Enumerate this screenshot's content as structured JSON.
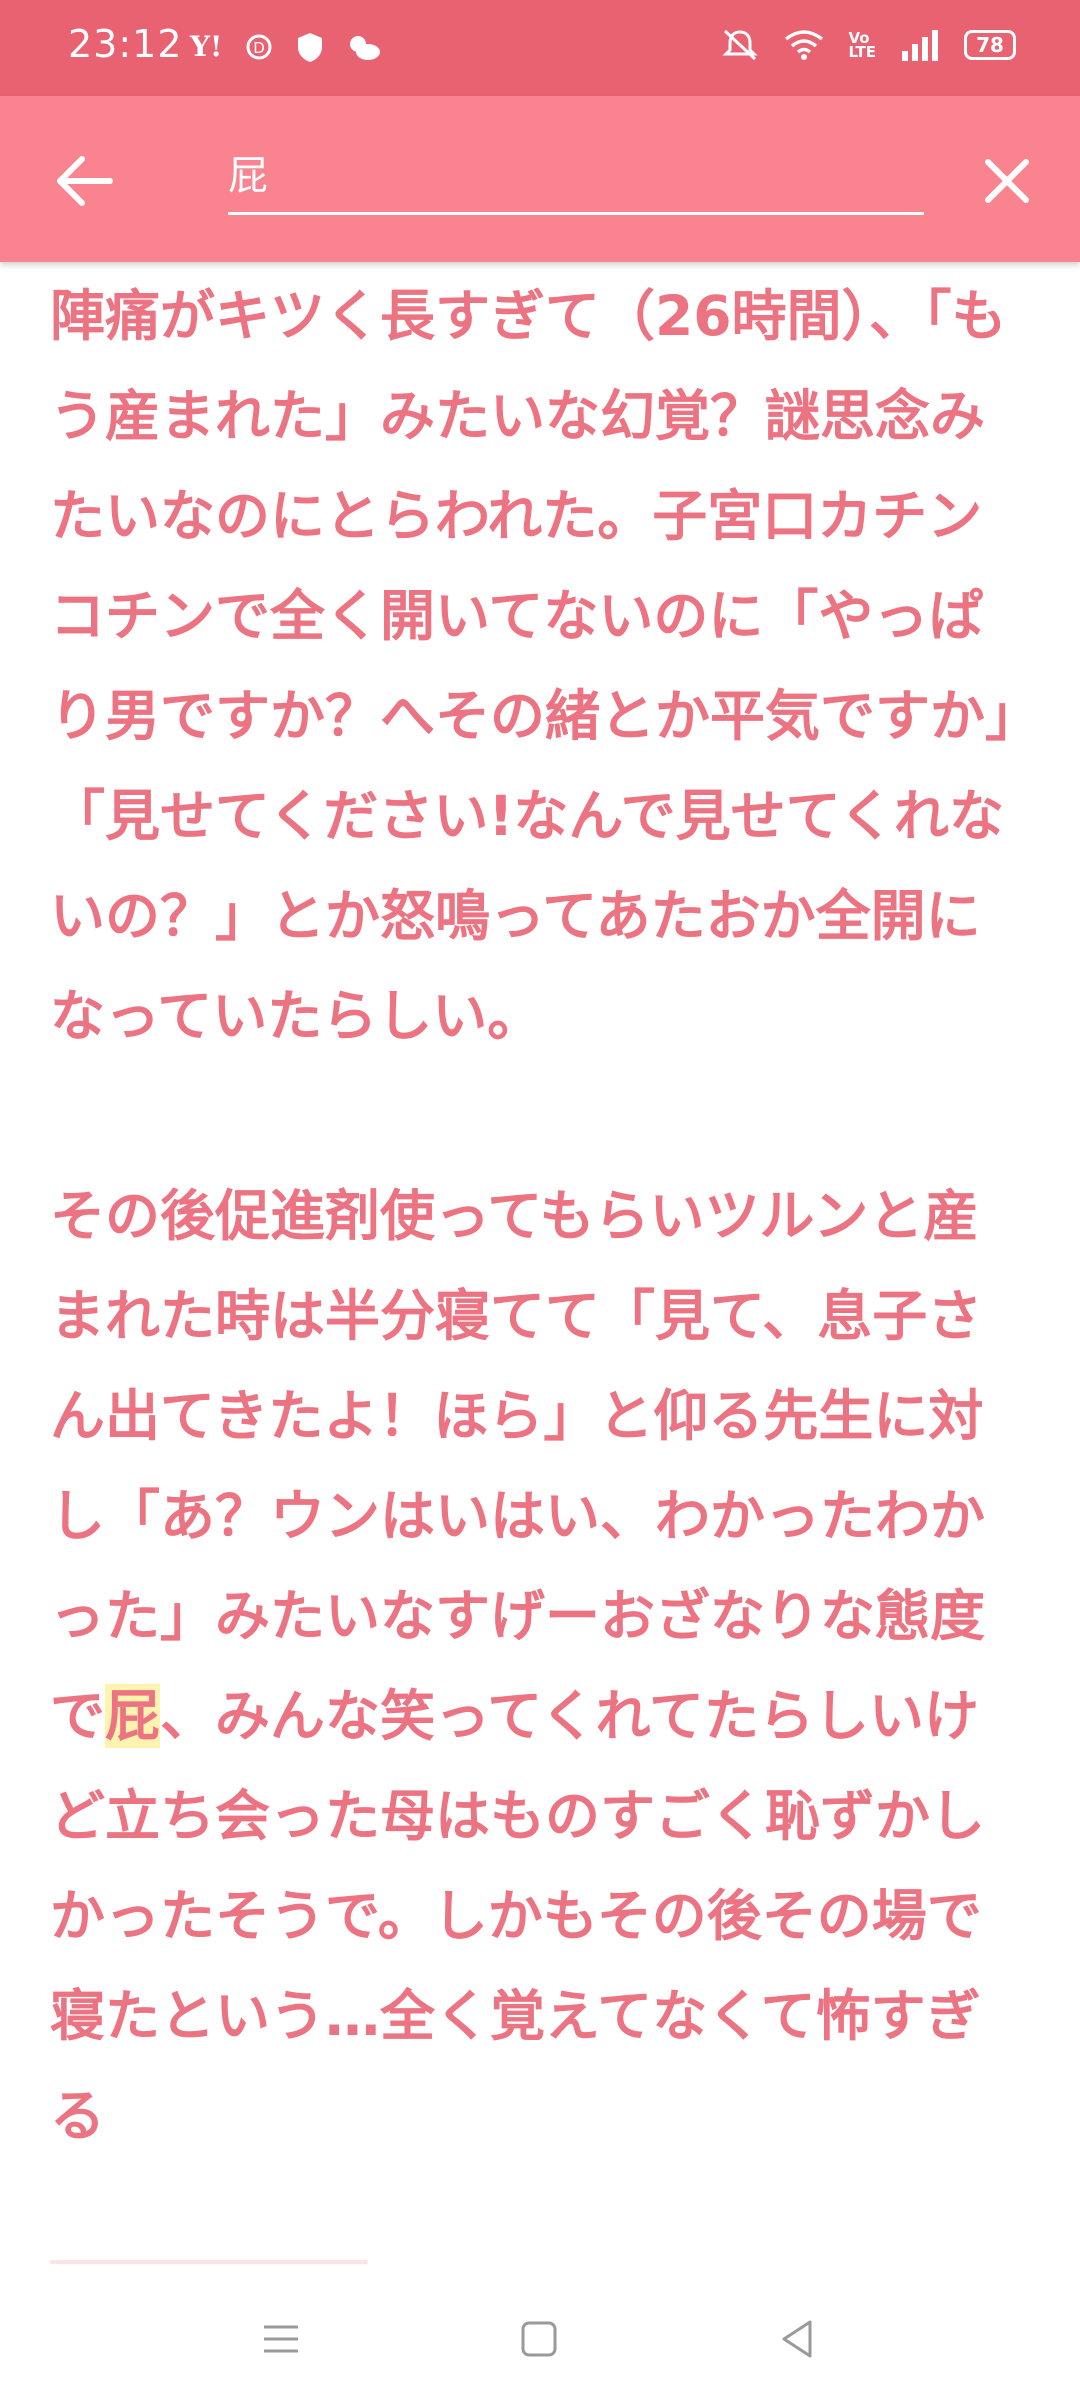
{
  "status_bar": {
    "time": "23:12",
    "left_icons": [
      "yahoo-icon",
      "data-saver-icon",
      "shield-icon",
      "weather-icon"
    ],
    "right_icons": [
      "mute-icon",
      "wifi-icon",
      "volte-icon",
      "signal-icon"
    ],
    "volte_label": "Vo\nLTE",
    "battery_level": "78"
  },
  "app_bar": {
    "search_value": "屁"
  },
  "content": {
    "paragraph1": "陣痛がキツく長すぎて（26時間）、「もう産まれた」みたいな幻覚？謎思念みたいなのにとらわれた。子宮口カチンコチンで全く開いてないのに「やっぱり男ですか？へその緒とか平気ですか」「見せてください!なんで見せてくれないの？」とか怒鳴ってあたおか全開になっていたらしい。",
    "paragraph2_before": "その後促進剤使ってもらいツルンと産まれた時は半分寝てて「見て、息子さん出てきたよ！ほら」と仰る先生に対し「あ？ウンはいはい、わかったわかった」みたいなすげーおざなりな態度で",
    "paragraph2_highlight": "屁",
    "paragraph2_after": "、みんな笑ってくれてたらしいけど立ち会った母はものすごく恥ずかしかったそうで。しかもその後その場で寝たという…全く覚えてなくて怖すぎる"
  },
  "colors": {
    "status_bar": "#e96272",
    "app_bar": "#f9838e",
    "text": "#ec7482",
    "highlight": "#fff3b0"
  },
  "navigation": {
    "icons": [
      "menu-icon",
      "home-icon",
      "back-icon"
    ]
  }
}
